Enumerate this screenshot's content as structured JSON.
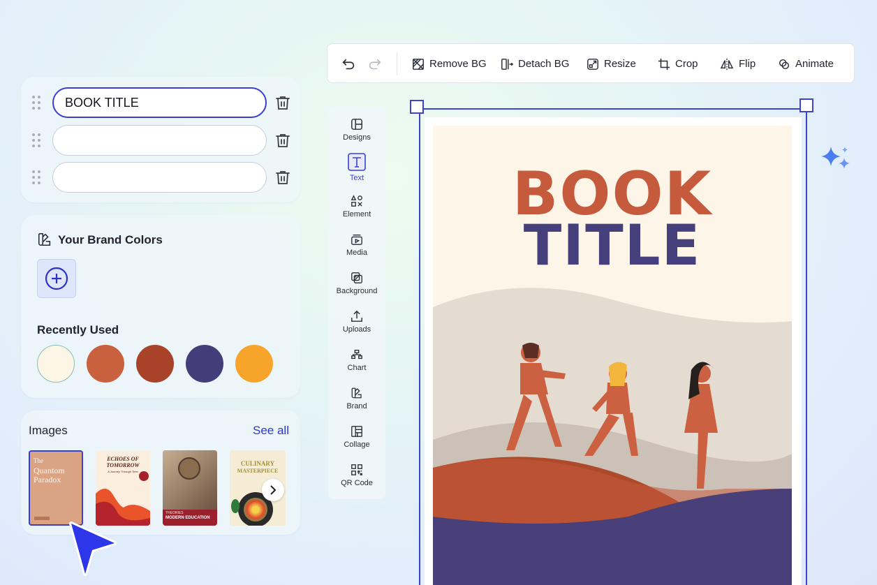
{
  "text_rows": [
    {
      "value": "BOOK TITLE",
      "placeholder": ""
    },
    {
      "value": "",
      "placeholder": ""
    },
    {
      "value": "",
      "placeholder": ""
    }
  ],
  "brand": {
    "title": "Your Brand Colors",
    "recent_title": "Recently Used",
    "recent_colors": [
      "#fdf5e6",
      "#c9603e",
      "#a8432a",
      "#433d7a",
      "#f7a42b"
    ]
  },
  "images": {
    "title": "Images",
    "see_all": "See all",
    "thumbs": [
      {
        "line1": "The",
        "line2": "Quantom",
        "line3": "Paradox"
      },
      {
        "line1": "ECHOES OF",
        "line2": "TOMORROW",
        "line3": "A Journey Through Time"
      },
      {
        "line1": "THEORIES",
        "line2": "MODERN EDUCATION"
      },
      {
        "line1": "CULINARY",
        "line2": "MASTERPIECE"
      }
    ]
  },
  "toolbar": {
    "undo_icon": "undo-icon",
    "redo_icon": "redo-icon",
    "remove_bg": "Remove BG",
    "detach_bg": "Detach BG",
    "resize": "Resize",
    "crop": "Crop",
    "flip": "Flip",
    "animate": "Animate"
  },
  "sidenav": [
    {
      "label": "Designs",
      "icon": "layout-icon"
    },
    {
      "label": "Text",
      "icon": "text-icon",
      "active": true
    },
    {
      "label": "Element",
      "icon": "shapes-icon"
    },
    {
      "label": "Media",
      "icon": "media-icon"
    },
    {
      "label": "Background",
      "icon": "background-icon"
    },
    {
      "label": "Uploads",
      "icon": "upload-icon"
    },
    {
      "label": "Chart",
      "icon": "chart-icon"
    },
    {
      "label": "Brand",
      "icon": "brand-icon"
    },
    {
      "label": "Collage",
      "icon": "collage-icon"
    },
    {
      "label": "QR Code",
      "icon": "qr-code-icon"
    }
  ],
  "canvas": {
    "title_line1": "BOOK",
    "title_line2": "TITLE",
    "color_line1": "#c65a3c",
    "color_line2": "#453f7c"
  },
  "accent": "#3b3fd0"
}
